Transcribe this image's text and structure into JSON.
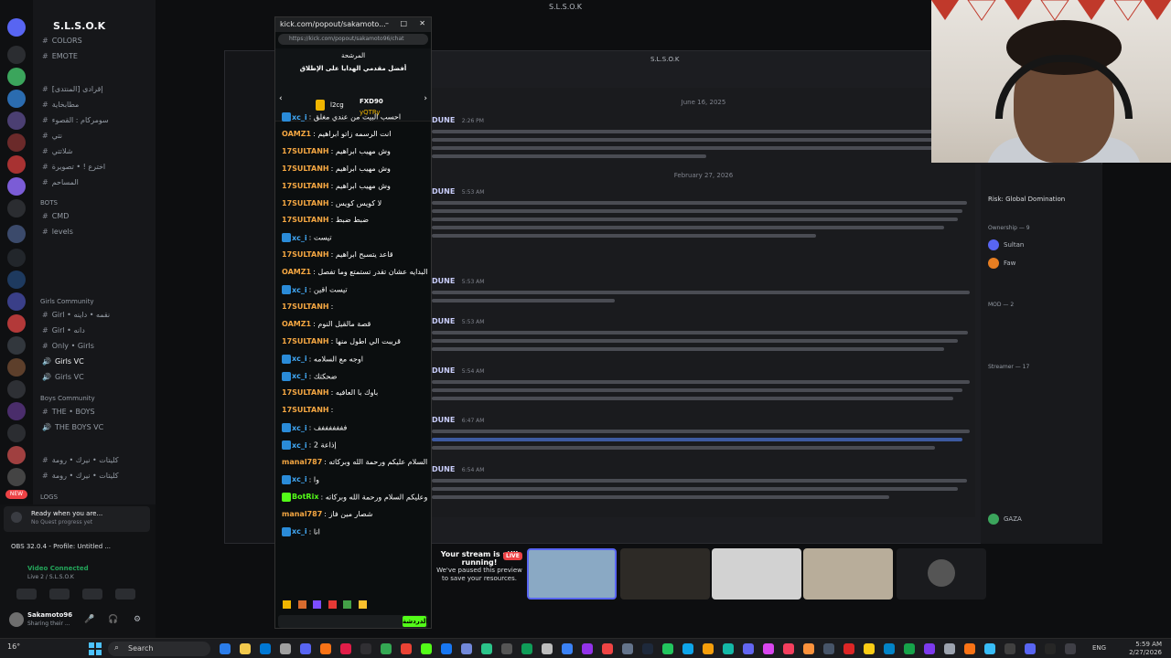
{
  "window_title": "S.L.S.O.K",
  "discord": {
    "server_name": "S.L.S.O.K",
    "channels": [
      {
        "label": "COLORS"
      },
      {
        "label": "EMOTE"
      },
      {
        "label": "[المنتدى] إقرادى"
      },
      {
        "label": "مطابخاية"
      },
      {
        "label": "سومركام : القصوء"
      },
      {
        "label": "نتي"
      },
      {
        "label": "شلاتتي"
      },
      {
        "label": "اخترع ! • تصويرة"
      },
      {
        "label": "المساحم"
      }
    ],
    "categories": {
      "bots": "BOTS",
      "girls_community": "Girls Community",
      "boys_community": "Boys Community",
      "logs": "LOGS"
    },
    "bot_channels": [
      "CMD",
      "levels"
    ],
    "girls_channels": [
      "Girl • نقمه • داينه",
      "Girl • دانه",
      "Only • Girls",
      "Girls VC",
      "Girls VC"
    ],
    "boys_channels": [
      "THE • BOYS",
      "THE BOYS VC"
    ],
    "other_channels": [
      "كليتات • نيرك • رومة",
      "كليتات • نيرك • رومة"
    ],
    "user_panel": {
      "notice_title": "Ready when you are...",
      "notice_sub": "No Quest progress yet",
      "obs_label": "OBS 32.0.4 - Profile: Untitled ...",
      "voice_status": "Video Connected",
      "voice_channel": "Live 2 / S.L.S.O.K",
      "username": "Sakamoto96",
      "user_status": "Sharing their ..."
    },
    "main_title": "S.L.S.O.K",
    "date_dividers": [
      "June 16, 2025",
      "February 27, 2026"
    ],
    "messages": [
      {
        "author": "DUNE",
        "time": "2:26 PM"
      },
      {
        "author": "DUNE",
        "time": "5:53 AM"
      },
      {
        "author": "DUNE",
        "time": "5:53 AM"
      },
      {
        "author": "DUNE",
        "time": "5:53 AM"
      },
      {
        "author": "DUNE",
        "time": "5:54 AM"
      },
      {
        "author": "DUNE",
        "time": "6:47 AM"
      },
      {
        "author": "DUNE",
        "time": "6:54 AM"
      }
    ],
    "members": {
      "activity": "Risk: Global Domination",
      "owner_header": "Ownership — 9",
      "mod_header": "MOD — 2",
      "streamer_header": "Streamer — 17",
      "names": [
        "Sultan",
        "Faw",
        "GAZA"
      ]
    }
  },
  "kick": {
    "title": "kick.com/popout/sakamoto...",
    "url": "https://kick.com/popout/sakamoto96/chat",
    "pinned_title": "المرشحة",
    "leaderboard_title": "أفضل مقدمي الهدايا على الإطلاق",
    "leaders": [
      "FXD90",
      "l2cg",
      "yQTRy"
    ],
    "messages": [
      {
        "user": "xc_i",
        "text": "احسب البيت من عندي مغلق",
        "color": "#43a9f5"
      },
      {
        "user": "OAMZ1",
        "text": "انت الرسمه زاتو ابراهيم",
        "color": "#f5a742"
      },
      {
        "user": "17SULTANH",
        "text": "وش مهيب ابراهيم",
        "color": "#f5a742"
      },
      {
        "user": "17SULTANH",
        "text": "وش مهيب ابراهيم",
        "color": "#f5a742"
      },
      {
        "user": "17SULTANH",
        "text": "وش مهيب ابراهيم",
        "color": "#f5a742"
      },
      {
        "user": "17SULTANH",
        "text": "لا كويس كويس",
        "color": "#f5a742"
      },
      {
        "user": "17SULTANH",
        "text": "ضبط ضبط",
        "color": "#f5a742"
      },
      {
        "user": "xc_i",
        "text": "تيست",
        "color": "#43a9f5"
      },
      {
        "user": "17SULTANH",
        "text": "قاعد يتسبح ابراهيم",
        "color": "#f5a742"
      },
      {
        "user": "OAMZ1",
        "text": "اقرا من البدايه عشان تقدر تستمتع وما تفصل",
        "color": "#f5a742"
      },
      {
        "user": "xc_i",
        "text": "تيست اقين",
        "color": "#43a9f5"
      },
      {
        "user": "17SULTANH",
        "text": "",
        "color": "#f5a742"
      },
      {
        "user": "OAMZ1",
        "text": "قصة مالقيل النوم",
        "color": "#f5a742"
      },
      {
        "user": "17SULTANH",
        "text": "قريبت الي اطول منها",
        "color": "#f5a742"
      },
      {
        "user": "xc_i",
        "text": "اوجه مع السلامه",
        "color": "#43a9f5"
      },
      {
        "user": "xc_i",
        "text": "ضحكتك",
        "color": "#43a9f5"
      },
      {
        "user": "17SULTANH",
        "text": "باوك با العافيه",
        "color": "#f5a742"
      },
      {
        "user": "17SULTANH",
        "text": "",
        "color": "#f5a742"
      },
      {
        "user": "xc_i",
        "text": "فففففففف",
        "color": "#43a9f5"
      },
      {
        "user": "xc_i",
        "text": "2 إذاعة",
        "color": "#43a9f5"
      },
      {
        "user": "manal787",
        "text": "السلام عليكم ورحمة الله وبركاته",
        "color": "#f5a742"
      },
      {
        "user": "xc_i",
        "text": "وا",
        "color": "#43a9f5"
      },
      {
        "user": "BotRix",
        "text": "وعليكم السلام ورحمة الله وبركاته",
        "color": "#53fc18"
      },
      {
        "user": "manal787",
        "text": "شصار مين فاز",
        "color": "#f5a742"
      },
      {
        "user": "xc_i",
        "text": "انا",
        "color": "#43a9f5"
      }
    ],
    "send_label": "الدردشة"
  },
  "preview": {
    "warn_title": "Your stream is still running!",
    "warn_body": "We've paused this preview to save your resources.",
    "live": "LIVE"
  },
  "taskbar": {
    "search": "Search",
    "lang": "ENG",
    "time": "5:59 AM",
    "date": "2/27/2026",
    "temp": "16°"
  }
}
